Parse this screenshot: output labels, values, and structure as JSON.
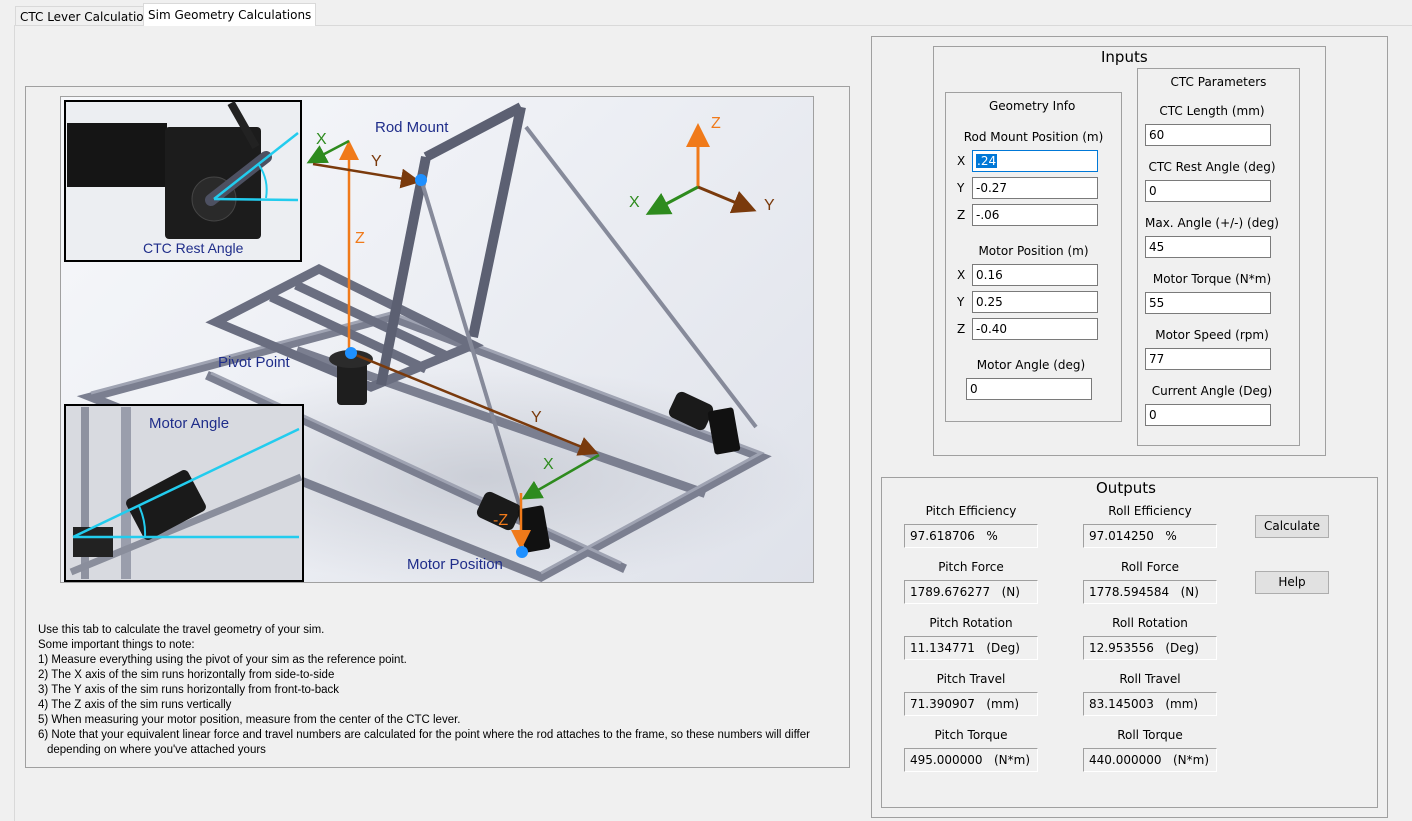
{
  "tabs": [
    {
      "label": "CTC Lever Calculations",
      "active": false
    },
    {
      "label": "Sim Geometry Calculations",
      "active": true
    }
  ],
  "diagram": {
    "labels": {
      "rod_mount": "Rod Mount",
      "pivot_point": "Pivot Point",
      "motor_position": "Motor Position",
      "ctc_rest_angle": "CTC Rest Angle",
      "motor_angle": "Motor Angle"
    },
    "axes": {
      "x": "X",
      "y": "Y",
      "z": "Z",
      "neg_z": "-Z"
    },
    "colors": {
      "x": "#2e8b1e",
      "y": "#7a3a0c",
      "z": "#f07a1a",
      "marker": "#1e90ff",
      "angle": "#22ccee",
      "label": "#1f2d8a"
    }
  },
  "notes": [
    "Use this tab to calculate the travel geometry of your sim.",
    "Some important things to note:",
    "1) Measure everything using the pivot of your sim as the reference point.",
    "2) The X axis of the sim runs horizontally from side-to-side",
    "3) The Y axis of the sim runs horizontally from front-to-back",
    "4) The Z axis of the sim runs vertically",
    "5) When measuring your motor position, measure from the center of the CTC lever.",
    "6) Note that your equivalent linear force and travel numbers are calculated for the point where the rod attaches to the frame, so these numbers will differ",
    "depending on where you've attached yours"
  ],
  "inputs": {
    "title": "Inputs",
    "geometry": {
      "title": "Geometry Info",
      "rod_mount": {
        "label": "Rod Mount Position (m)",
        "x": ".24",
        "y": "-0.27",
        "z": "-.06"
      },
      "motor": {
        "label": "Motor Position (m)",
        "x": "0.16",
        "y": "0.25",
        "z": "-0.40"
      },
      "motor_angle": {
        "label": "Motor Angle (deg)",
        "value": "0"
      },
      "axis_labels": {
        "x": "X",
        "y": "Y",
        "z": "Z"
      }
    },
    "ctc": {
      "title": "CTC Parameters",
      "length": {
        "label": "CTC Length (mm)",
        "value": "60"
      },
      "rest_angle": {
        "label": "CTC Rest Angle (deg)",
        "value": "0"
      },
      "max_angle": {
        "label": "Max. Angle (+/-) (deg)",
        "value": "45"
      },
      "motor_torque": {
        "label": "Motor Torque (N*m)",
        "value": "55"
      },
      "motor_speed": {
        "label": "Motor Speed (rpm)",
        "value": "77"
      },
      "current_angle": {
        "label": "Current Angle (Deg)",
        "value": "0"
      }
    }
  },
  "outputs": {
    "title": "Outputs",
    "pitch_efficiency": {
      "label": "Pitch Efficiency",
      "value": "97.618706   %"
    },
    "roll_efficiency": {
      "label": "Roll Efficiency",
      "value": "97.014250   %"
    },
    "pitch_force": {
      "label": "Pitch Force",
      "value": "1789.676277   (N)"
    },
    "roll_force": {
      "label": "Roll Force",
      "value": "1778.594584   (N)"
    },
    "pitch_rotation": {
      "label": "Pitch Rotation",
      "value": "11.134771   (Deg)"
    },
    "roll_rotation": {
      "label": "Roll Rotation",
      "value": "12.953556   (Deg)"
    },
    "pitch_travel": {
      "label": "Pitch Travel",
      "value": "71.390907   (mm)"
    },
    "roll_travel": {
      "label": "Roll Travel",
      "value": "83.145003   (mm)"
    },
    "pitch_torque": {
      "label": "Pitch Torque",
      "value": "495.000000   (N*m)"
    },
    "roll_torque": {
      "label": "Roll Torque",
      "value": "440.000000   (N*m)"
    }
  },
  "buttons": {
    "calculate": "Calculate",
    "help": "Help"
  }
}
